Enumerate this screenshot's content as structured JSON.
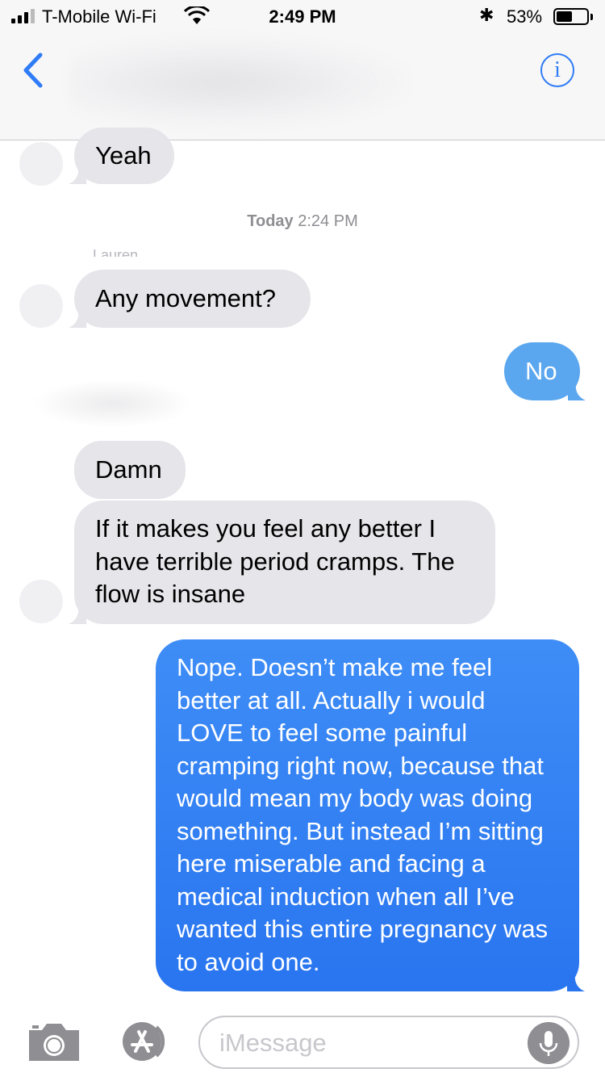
{
  "status_bar": {
    "carrier": "T-Mobile Wi-Fi",
    "time": "2:49 PM",
    "battery_percent": "53%",
    "battery_level": 0.53
  },
  "header": {
    "back_icon": "chevron-left-icon",
    "info_icon": "info-icon",
    "info_glyph": "i",
    "accent_color": "#2f7cf6"
  },
  "thread": {
    "timestamp_day": "Today",
    "timestamp_time": "2:24 PM",
    "sender_label": "Lauren",
    "messages": [
      {
        "from": "them",
        "text": "Yeah"
      },
      {
        "from": "them",
        "text": "Any movement?"
      },
      {
        "from": "me",
        "text": "No"
      },
      {
        "from": "them",
        "text": "Damn"
      },
      {
        "from": "them",
        "text": "If it makes you feel any better I have terrible period cramps. The flow is insane"
      },
      {
        "from": "me",
        "text": "Nope. Doesn’t make me feel better at all. Actually i would LOVE to feel some painful cramping right now, because that would mean my body was doing something. But instead I’m sitting here miserable and facing a medical induction when all I’ve wanted this entire pregnancy was to avoid one."
      }
    ]
  },
  "input_bar": {
    "placeholder": "iMessage",
    "camera_icon": "camera-icon",
    "appstore_icon": "app-store-icon",
    "mic_icon": "microphone-icon"
  }
}
